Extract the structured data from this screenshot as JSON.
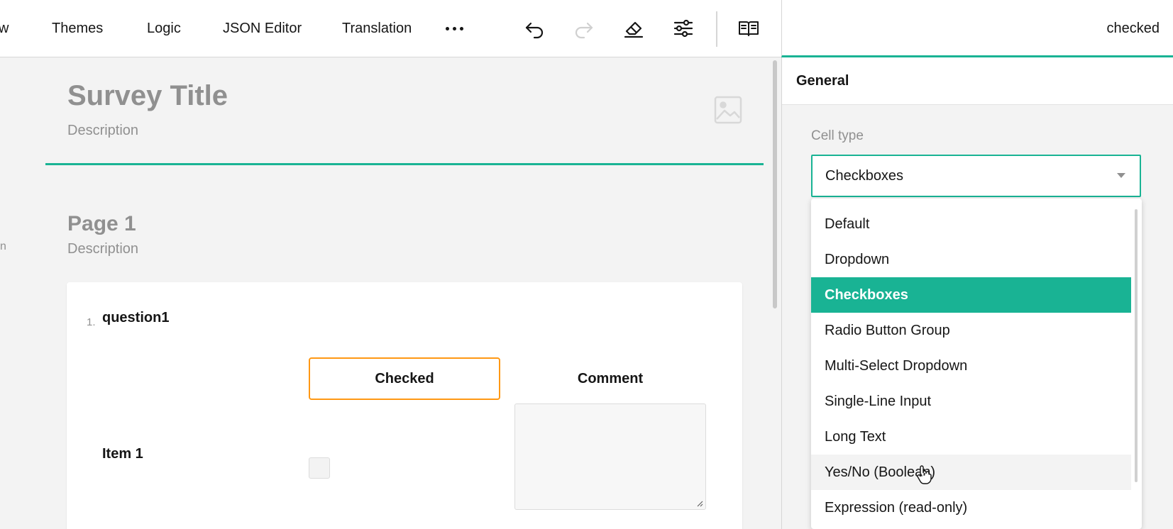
{
  "toolbar": {
    "tabs": [
      {
        "label": "w"
      },
      {
        "label": "Themes"
      },
      {
        "label": "Logic"
      },
      {
        "label": "JSON Editor"
      },
      {
        "label": "Translation"
      }
    ],
    "icons": [
      "more-icon",
      "undo-icon",
      "redo-icon",
      "eraser-icon",
      "settings-icon",
      "book-icon"
    ]
  },
  "panel": {
    "header_text": "checked",
    "section": "General",
    "cell_type_label": "Cell type",
    "cell_type_value": "Checkboxes",
    "options": [
      {
        "label": "Default"
      },
      {
        "label": "Dropdown"
      },
      {
        "label": "Checkboxes"
      },
      {
        "label": "Radio Button Group"
      },
      {
        "label": "Multi-Select Dropdown"
      },
      {
        "label": "Single-Line Input"
      },
      {
        "label": "Long Text"
      },
      {
        "label": "Yes/No (Boolean)"
      },
      {
        "label": "Expression (read-only)"
      }
    ],
    "selected_option": "Checkboxes",
    "hovered_option": "Yes/No (Boolean)"
  },
  "survey": {
    "title": "Survey Title",
    "description": "Description",
    "page_title": "Page 1",
    "page_description": "Description",
    "question_number": "1.",
    "question_title": "question1",
    "columns": [
      {
        "label": "Checked"
      },
      {
        "label": "Comment"
      }
    ],
    "rows": [
      {
        "label": "Item 1"
      }
    ],
    "left_edge_glyph": "n"
  },
  "colors": {
    "accent": "#19b394",
    "selected_column_border": "#ff9814",
    "muted_text": "#909090"
  }
}
